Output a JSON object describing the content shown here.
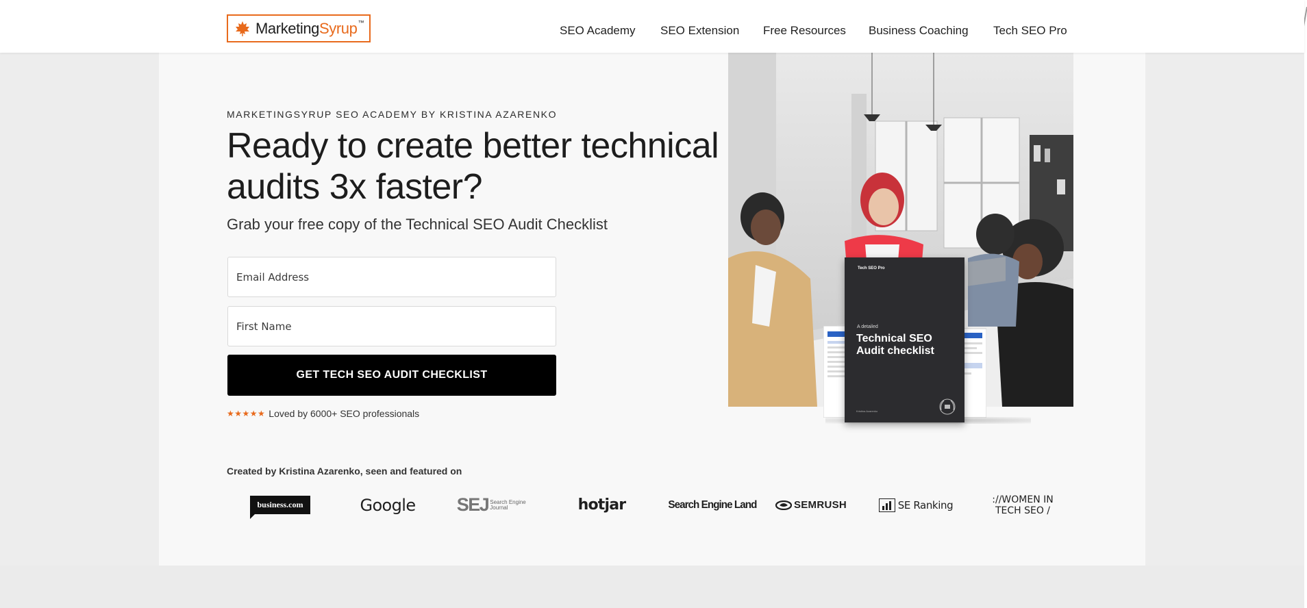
{
  "brand": {
    "logo_word_1": "Marketing",
    "logo_word_2": "Syrup",
    "logo_tm": "™",
    "accent_color": "#e86a1c"
  },
  "nav": {
    "items": [
      {
        "label": "SEO Academy"
      },
      {
        "label": "SEO Extension"
      },
      {
        "label": "Free Resources"
      },
      {
        "label": "Business Coaching"
      },
      {
        "label": "Tech SEO Pro"
      }
    ]
  },
  "hero": {
    "eyebrow": "MARKETINGSYRUP SEO ACADEMY BY KRISTINA AZARENKO",
    "headline": "Ready to create better technical SEO audits 3x faster?",
    "subhead": "Grab your free copy of the Technical SEO Audit Checklist",
    "email_placeholder": "Email Address",
    "name_placeholder": "First Name",
    "cta_label": "GET TECH SEO AUDIT CHECKLIST",
    "stars": "★★★★★",
    "rating_text": "Loved by 6000+ SEO professionals"
  },
  "book": {
    "brand": "Tech SEO Pro",
    "small": "A detailed",
    "title": "Technical SEO Audit checklist",
    "author": "Kristina Azarenko"
  },
  "featured": {
    "label": "Created by Kristina Azarenko, seen and featured on",
    "logos": [
      {
        "name": "business.com"
      },
      {
        "name": "Google"
      },
      {
        "name": "SEJ",
        "sub": "Search Engine Journal"
      },
      {
        "name": "hotjar"
      },
      {
        "name": "Search Engine Land"
      },
      {
        "name": "SEMRUSH"
      },
      {
        "name": "SE Ranking"
      },
      {
        "name": "://WOMEN IN TECH SEO /"
      }
    ]
  }
}
